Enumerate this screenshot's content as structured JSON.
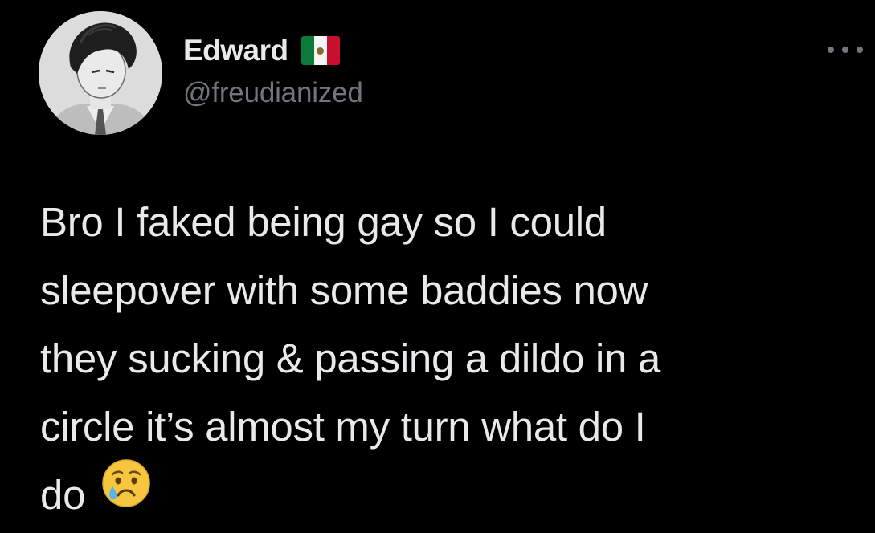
{
  "tweet": {
    "display_name": "Edward",
    "flag_icon": "mexico-flag-icon",
    "handle": "@freudianized",
    "more_icon": "more-options-icon",
    "text_lines": [
      "Bro I faked being gay so I could",
      "sleepover with some baddies now",
      "they sucking & passing a dildo in a",
      "circle it’s almost my turn what do I",
      "do"
    ],
    "emoji_icon": "crying-face-emoji-icon"
  },
  "colors": {
    "background": "#000000",
    "primary_text": "#e7e9ea",
    "secondary_text": "#71767b"
  }
}
